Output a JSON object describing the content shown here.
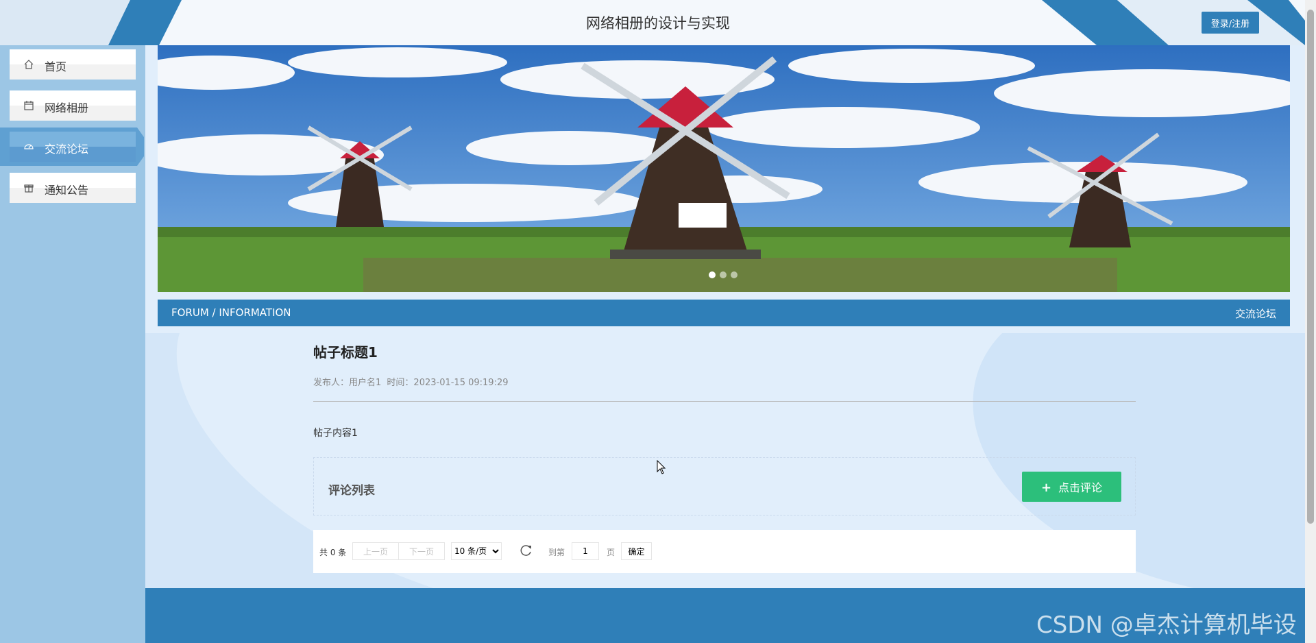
{
  "header": {
    "title": "网络相册的设计与实现",
    "login_label": "登录/注册"
  },
  "sidebar": {
    "items": [
      {
        "label": "首页",
        "icon": "home-icon",
        "active": false
      },
      {
        "label": "网络相册",
        "icon": "calendar-icon",
        "active": false
      },
      {
        "label": "交流论坛",
        "icon": "dashboard-icon",
        "active": true
      },
      {
        "label": "通知公告",
        "icon": "gift-icon",
        "active": false
      }
    ]
  },
  "banner": {
    "slide_count": 3,
    "active_slide": 1
  },
  "section": {
    "left_label": "FORUM / INFORMATION",
    "right_label": "交流论坛"
  },
  "post": {
    "title": "帖子标题1",
    "author_label": "发布人：用户名1",
    "time_label": "时间：2023-01-15 09:19:29",
    "content": "帖子内容1"
  },
  "comments": {
    "title": "评论列表",
    "add_label": "点击评论"
  },
  "pagination": {
    "total": "共 0 条",
    "prev": "上一页",
    "next": "下一页",
    "page_size": "10 条/页",
    "goto_label": "到第",
    "page_value": "1",
    "page_suffix": "页",
    "confirm": "确定"
  },
  "watermark": "CSDN @卓杰计算机毕设",
  "colors": {
    "primary": "#2f7fb8",
    "success": "#2cbf7b",
    "sidebar": "#9cc6e5",
    "content_bg": "#e1eefb"
  }
}
